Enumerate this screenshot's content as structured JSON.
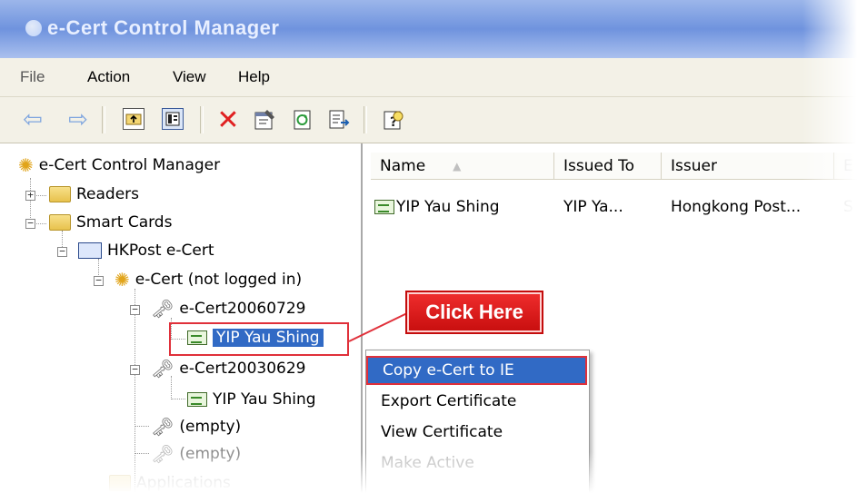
{
  "window": {
    "title": "e-Cert Control Manager"
  },
  "menu": [
    "File",
    "Action",
    "View",
    "Help"
  ],
  "toolbar_icons": [
    "back-icon",
    "forward-icon",
    "up-folder-icon",
    "show-tree-icon",
    "delete-icon",
    "properties-icon",
    "refresh-icon",
    "export-list-icon",
    "help-icon"
  ],
  "tree": {
    "root": "e-Cert Control Manager",
    "readers": "Readers",
    "smart_cards": "Smart Cards",
    "hkpost": "HKPost e-Cert",
    "ecert": "e-Cert (not logged in)",
    "cert1": "e-Cert20060729",
    "cert1_child": "YIP Yau Shing",
    "cert2": "e-Cert20030629",
    "cert2_child": "YIP Yau Shing",
    "empty1": "(empty)",
    "empty2": "(empty)",
    "applications": "Applications"
  },
  "list": {
    "columns": [
      "Name",
      "Issued To",
      "Issuer",
      "E"
    ],
    "sort_indicator": "▲",
    "row": {
      "name": "YIP Yau Shing",
      "issued_to": "YIP Ya...",
      "issuer": "Hongkong Post...",
      "extra": "S"
    }
  },
  "callout": {
    "label": "Click Here"
  },
  "context_menu": {
    "items": [
      {
        "label": "Copy e-Cert to IE",
        "state": "active"
      },
      {
        "label": "Export Certificate",
        "state": "normal"
      },
      {
        "label": "View Certificate",
        "state": "normal"
      },
      {
        "label": "Make Active",
        "state": "disabled"
      }
    ]
  },
  "colors": {
    "selection": "#316ac5",
    "callout_red": "#e0303a",
    "titlebar": "#6f93de"
  }
}
